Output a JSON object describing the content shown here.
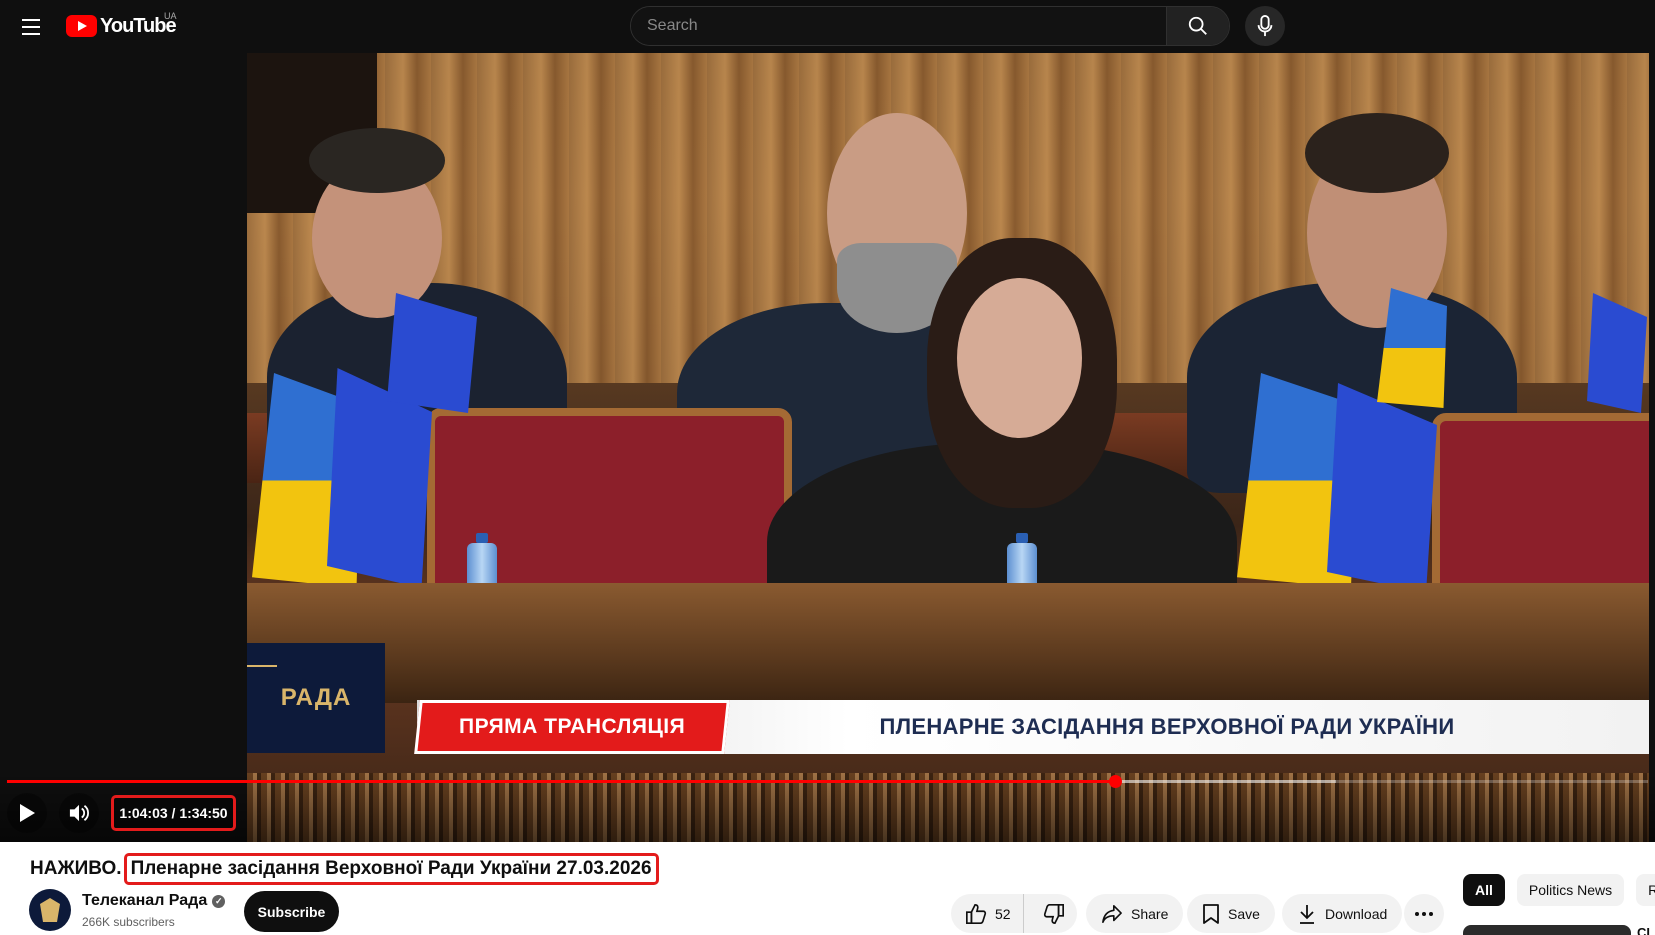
{
  "header": {
    "logo_text": "YouTube",
    "country_code": "UA",
    "search_placeholder": "Search"
  },
  "player": {
    "current_time": "1:04:03",
    "duration": "1:34:50",
    "time_display": "1:04:03 / 1:34:50",
    "progress_fraction": 0.675,
    "buffered_fraction": 0.81,
    "overlay": {
      "channel_logo_text": "РАДА",
      "live_label": "ПРЯМА ТРАНСЛЯЦІЯ",
      "banner_title": "ПЛЕНАРНЕ ЗАСІДАННЯ ВЕРХОВНОЇ РАДИ УКРАЇНИ"
    }
  },
  "video": {
    "title_prefix": "НАЖИВО.",
    "title_main": "Пленарне засідання Верховної Ради України 27.03.2026"
  },
  "channel": {
    "name": "Телеканал Рада",
    "subscribers": "266K subscribers",
    "subscribe_label": "Subscribe"
  },
  "actions": {
    "like_count": "52",
    "share_label": "Share",
    "save_label": "Save",
    "download_label": "Download"
  },
  "chips": [
    {
      "label": "All",
      "active": true
    },
    {
      "label": "Politics News",
      "active": false
    },
    {
      "label": "Re",
      "active": false
    }
  ],
  "recommendation": {
    "title_fragment": "CI"
  },
  "icons": [
    "menu-icon",
    "youtube-logo-icon",
    "search-icon",
    "mic-icon",
    "play-icon",
    "volume-icon",
    "like-icon",
    "dislike-icon",
    "share-icon",
    "save-icon",
    "download-icon",
    "more-icon",
    "verified-icon"
  ],
  "colors": {
    "brand_red": "#ff0000",
    "highlight_red": "#e31b1b",
    "header_bg": "#0f0f0f"
  }
}
